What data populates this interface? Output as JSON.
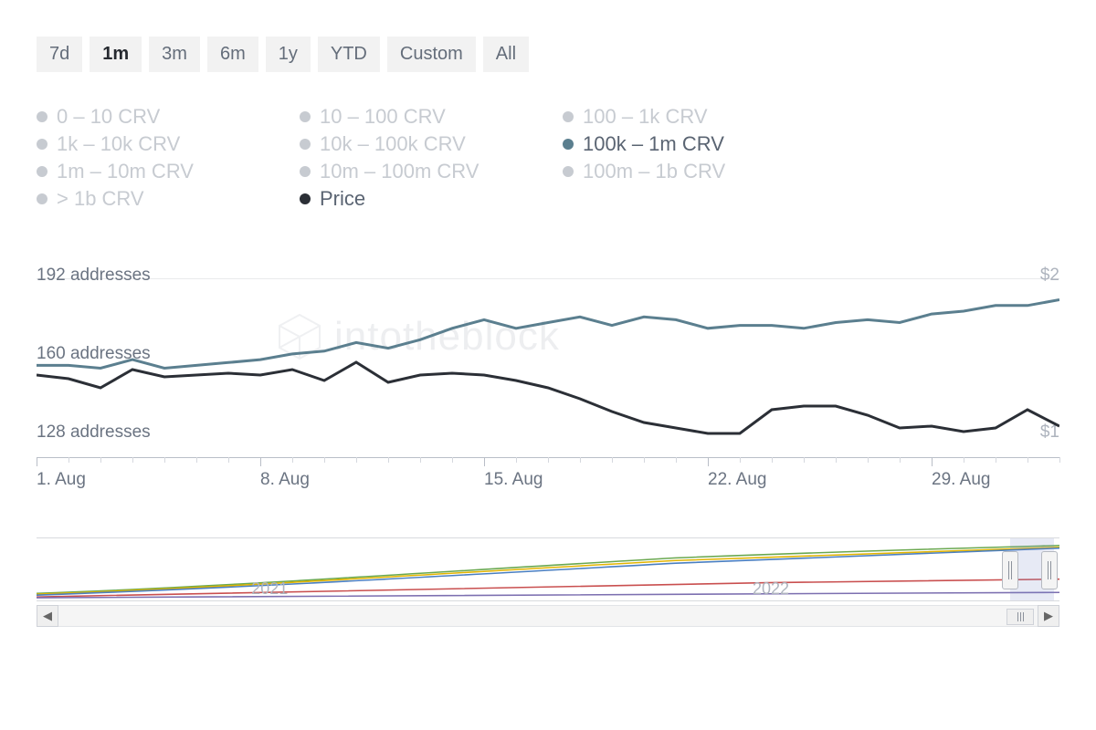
{
  "range_buttons": [
    "7d",
    "1m",
    "3m",
    "6m",
    "1y",
    "YTD",
    "Custom",
    "All"
  ],
  "range_active": "1m",
  "legend": {
    "rows": [
      [
        "0 – 10 CRV",
        "10 – 100 CRV",
        "100 – 1k CRV"
      ],
      [
        "1k – 10k CRV",
        "10k – 100k CRV",
        "100k – 1m CRV"
      ],
      [
        "1m – 10m CRV",
        "10m – 100m CRV",
        "100m – 1b CRV"
      ],
      [
        "> 1b CRV",
        "Price",
        ""
      ]
    ],
    "active_addr": "100k – 1m CRV",
    "active_price": "Price"
  },
  "y_left_labels": {
    "top": "192 addresses",
    "mid": "160 addresses",
    "bot": "128 addresses"
  },
  "y_right_labels": {
    "top": "$2",
    "bot": "$1"
  },
  "x_labels": [
    "1. Aug",
    "8. Aug",
    "15. Aug",
    "22. Aug",
    "29. Aug"
  ],
  "watermark_text": "intotheblock",
  "navigator_years": [
    "2021",
    "2022"
  ],
  "chart_data": {
    "type": "line",
    "title": "",
    "xlabel": "",
    "y_left": {
      "label": "addresses",
      "ylim": [
        128,
        192
      ]
    },
    "y_right": {
      "label": "price_usd",
      "ylim": [
        1,
        2
      ]
    },
    "categories": [
      "1. Aug",
      "2. Aug",
      "3. Aug",
      "4. Aug",
      "5. Aug",
      "6. Aug",
      "7. Aug",
      "8. Aug",
      "9. Aug",
      "10. Aug",
      "11. Aug",
      "12. Aug",
      "13. Aug",
      "14. Aug",
      "15. Aug",
      "16. Aug",
      "17. Aug",
      "18. Aug",
      "19. Aug",
      "20. Aug",
      "21. Aug",
      "22. Aug",
      "23. Aug",
      "24. Aug",
      "25. Aug",
      "26. Aug",
      "27. Aug",
      "28. Aug",
      "29. Aug",
      "30. Aug",
      "31. Aug",
      "1. Sep",
      "2. Sep"
    ],
    "series": [
      {
        "name": "100k – 1m CRV",
        "axis": "left",
        "color": "#5b7f8f",
        "values": [
          157,
          157,
          156,
          159,
          156,
          157,
          158,
          159,
          161,
          162,
          165,
          163,
          166,
          170,
          173,
          170,
          172,
          174,
          171,
          174,
          173,
          170,
          171,
          171,
          170,
          172,
          173,
          172,
          175,
          176,
          178,
          178,
          180
        ]
      },
      {
        "name": "Price",
        "axis": "right",
        "color": "#2b2f36",
        "values": [
          1.4,
          1.38,
          1.33,
          1.43,
          1.39,
          1.4,
          1.41,
          1.4,
          1.43,
          1.37,
          1.47,
          1.36,
          1.4,
          1.41,
          1.4,
          1.37,
          1.33,
          1.27,
          1.2,
          1.14,
          1.11,
          1.08,
          1.08,
          1.21,
          1.23,
          1.23,
          1.18,
          1.11,
          1.12,
          1.09,
          1.11,
          1.21,
          1.12
        ]
      }
    ]
  }
}
